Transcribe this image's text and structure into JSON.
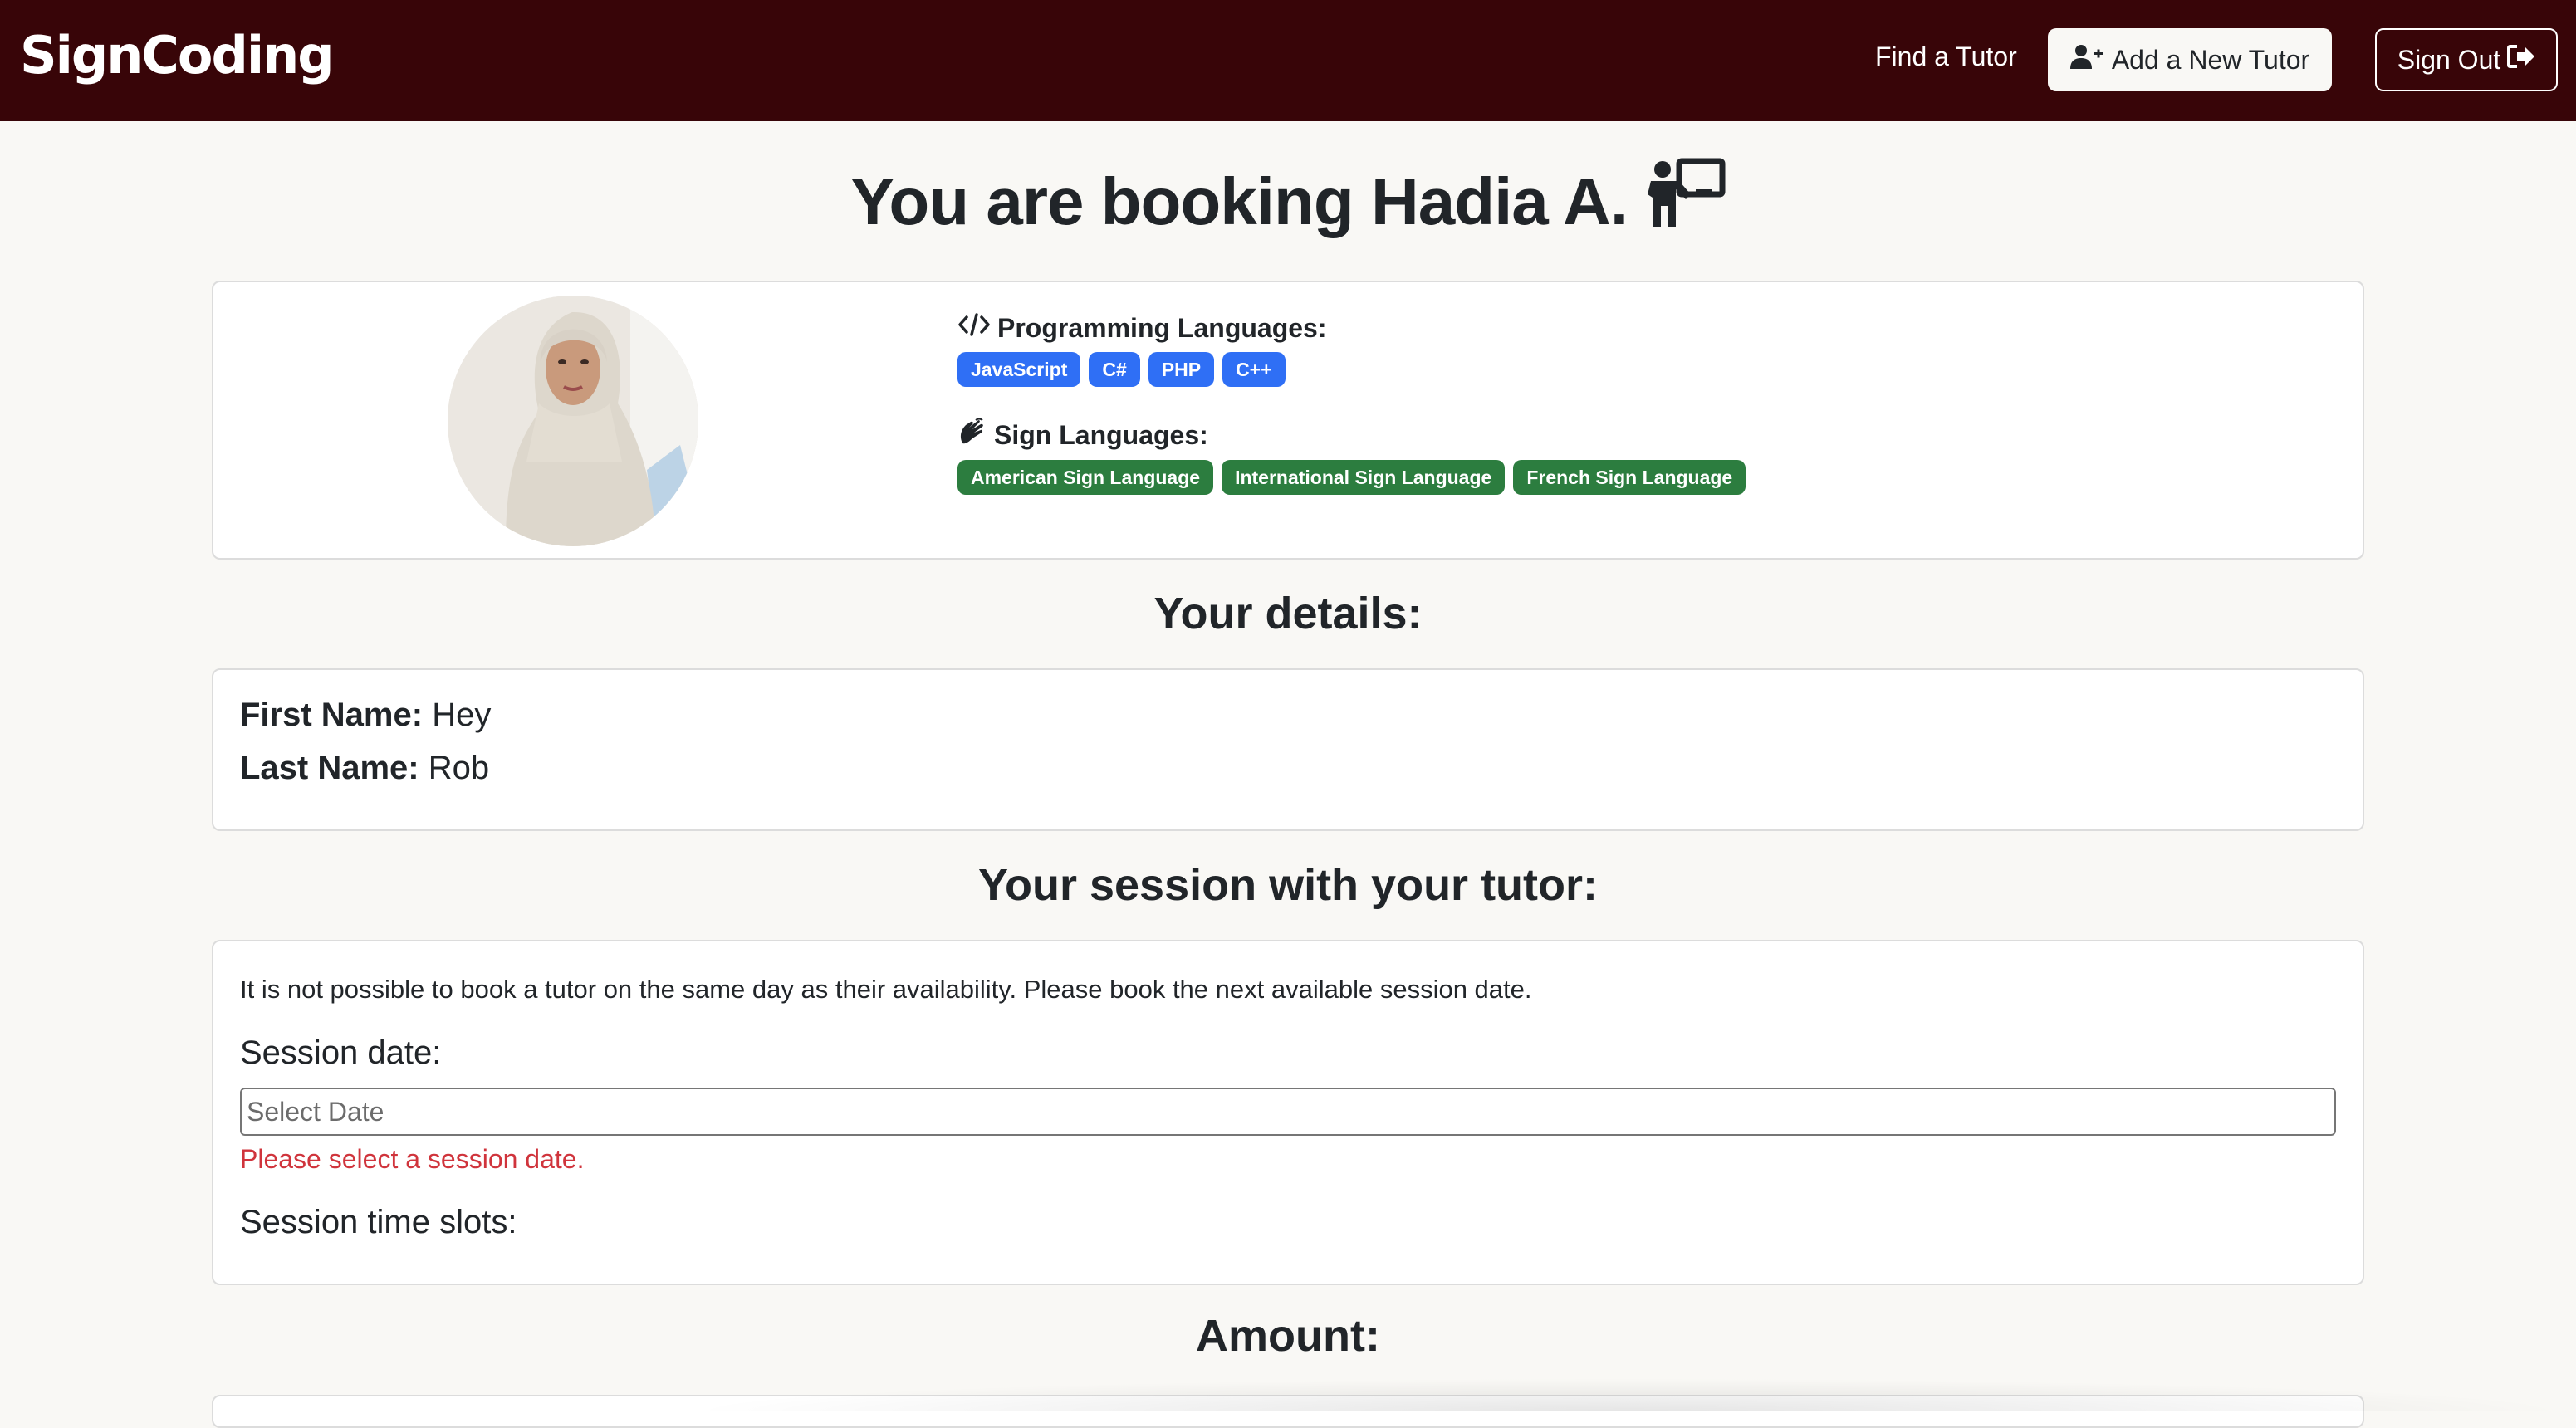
{
  "navbar": {
    "brand": "SignCoding",
    "find_tutor": "Find a Tutor",
    "add_tutor": "Add a New Tutor",
    "sign_out": "Sign Out"
  },
  "page": {
    "title": "You are booking Hadia A."
  },
  "tutor": {
    "programming_heading": "Programming Languages:",
    "programming_languages": [
      "JavaScript",
      "C#",
      "PHP",
      "C++"
    ],
    "sign_heading": "Sign Languages:",
    "sign_languages": [
      "American Sign Language",
      "International Sign Language",
      "French Sign Language"
    ],
    "colors": {
      "programming_badge": "#2f6ff5",
      "sign_badge": "#2c7d3f"
    }
  },
  "details": {
    "heading": "Your details:",
    "first_name_label": "First Name:",
    "first_name_value": "Hey",
    "last_name_label": "Last Name:",
    "last_name_value": "Rob"
  },
  "session": {
    "heading": "Your session with your tutor:",
    "notice": "It is not possible to book a tutor on the same day as their availability. Please book the next available session date.",
    "date_label": "Session date:",
    "date_placeholder": "Select Date",
    "date_error": "Please select a session date.",
    "slots_label": "Session time slots:"
  },
  "amount": {
    "heading": "Amount:"
  },
  "theme": {
    "navbar_bg": "#380508",
    "page_bg": "#f9f8f5",
    "error_color": "#d0343c"
  }
}
